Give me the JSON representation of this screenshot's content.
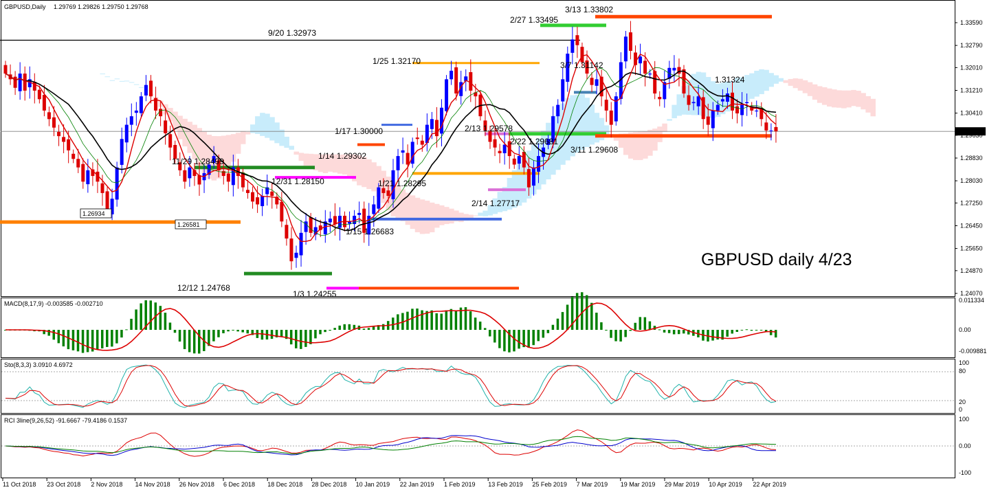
{
  "header": {
    "symbol": "GBPUSD,Daily",
    "ohlc": "1.29769 1.29826 1.29750 1.29768"
  },
  "overlay_title": "GBPUSD daily 4/23",
  "current_price_tag": "1.29768",
  "indicators": {
    "macd": {
      "label": "MACD(8,17,9) -0.003585 -0.002710",
      "axis": [
        "0.011334",
        "0.00",
        "-0.009881"
      ],
      "colors": {
        "histogram": "#008000",
        "signal": "#dd0000"
      }
    },
    "stoch": {
      "label": "Sto(8,3,3) 3.0910 4.6972",
      "axis": [
        "100",
        "80",
        "20",
        "0"
      ]
    },
    "rci": {
      "label": "RCI 3line(9,26,52) -91.6667 -79.4186 0.1537",
      "axis": [
        "100",
        "0.00",
        "-100"
      ]
    }
  },
  "chart_data": {
    "type": "candlestick",
    "instrument": "GBPUSD",
    "timeframe": "Daily",
    "ylim": [
      1.2407,
      1.3397
    ],
    "y_ticks": [
      "1.33590",
      "1.32790",
      "1.32010",
      "1.31210",
      "1.30410",
      "1.29630",
      "1.28830",
      "1.28030",
      "1.27250",
      "1.26450",
      "1.25650",
      "1.24870",
      "1.24070"
    ],
    "x_ticks": [
      "11 Oct 2018",
      "23 Oct 2018",
      "2 Nov 2018",
      "14 Nov 2018",
      "26 Nov 2018",
      "6 Dec 2018",
      "18 Dec 2018",
      "28 Dec 2018",
      "10 Jan 2019",
      "22 Jan 2019",
      "1 Feb 2019",
      "13 Feb 2019",
      "25 Feb 2019",
      "7 Mar 2019",
      "19 Mar 2019",
      "29 Mar 2019",
      "10 Apr 2019",
      "22 Apr 2019"
    ],
    "colors": {
      "bull": "#0000ff",
      "bear": "#dd0000",
      "tenkan": "#dd0000",
      "kijun": "#000000",
      "chikou": "#008000",
      "cloud_bull": "#c8ecfb",
      "cloud_bear": "#fddada"
    },
    "close": [
      1.318,
      1.316,
      1.313,
      1.318,
      1.312,
      1.316,
      1.312,
      1.309,
      1.305,
      1.302,
      1.299,
      1.296,
      1.294,
      1.291,
      1.288,
      1.285,
      1.28,
      1.284,
      1.282,
      1.28,
      1.276,
      1.27,
      1.274,
      1.285,
      1.295,
      1.3,
      1.303,
      1.305,
      1.31,
      1.314,
      1.31,
      1.305,
      1.303,
      1.297,
      1.292,
      1.288,
      1.284,
      1.28,
      1.285,
      1.282,
      1.279,
      1.283,
      1.286,
      1.289,
      1.284,
      1.282,
      1.28,
      1.285,
      1.282,
      1.278,
      1.276,
      1.273,
      1.272,
      1.275,
      1.278,
      1.275,
      1.272,
      1.266,
      1.26,
      1.252,
      1.255,
      1.262,
      1.266,
      1.262,
      1.264,
      1.263,
      1.266,
      1.267,
      1.265,
      1.268,
      1.264,
      1.266,
      1.268,
      1.269,
      1.262,
      1.268,
      1.272,
      1.278,
      1.276,
      1.275,
      1.284,
      1.289,
      1.291,
      1.286,
      1.294,
      1.295,
      1.293,
      1.3,
      1.302,
      1.296,
      1.306,
      1.316,
      1.319,
      1.311,
      1.315,
      1.317,
      1.312,
      1.31,
      1.303,
      1.298,
      1.294,
      1.292,
      1.29,
      1.293,
      1.289,
      1.286,
      1.289,
      1.285,
      1.278,
      1.285,
      1.289,
      1.292,
      1.295,
      1.303,
      1.307,
      1.316,
      1.325,
      1.33,
      1.328,
      1.322,
      1.318,
      1.314,
      1.316,
      1.31,
      1.305,
      1.3,
      1.31,
      1.322,
      1.331,
      1.326,
      1.321,
      1.324,
      1.318,
      1.318,
      1.311,
      1.309,
      1.315,
      1.32,
      1.32,
      1.318,
      1.311,
      1.307,
      1.308,
      1.31,
      1.302,
      1.3,
      1.305,
      1.307,
      1.309,
      1.311,
      1.305,
      1.304,
      1.307,
      1.308,
      1.305,
      1.305,
      1.302,
      1.298,
      1.298,
      1.2977
    ],
    "annotations": [
      {
        "text": "9/20 1.32973",
        "value": 1.32973
      },
      {
        "text": "3/13 1.33802",
        "value": 1.33802
      },
      {
        "text": "2/27 1.33495",
        "value": 1.33495
      },
      {
        "text": "1/25 1.32170",
        "value": 1.3217
      },
      {
        "text": "3/7 1.31142",
        "value": 1.31142
      },
      {
        "text": "1.31324",
        "value": 1.31324
      },
      {
        "text": "1/17 1.30000",
        "value": 1.3
      },
      {
        "text": "2/13 1.29578",
        "value": 1.29578
      },
      {
        "text": "2/22 1.29681",
        "value": 1.29681
      },
      {
        "text": "3/11 1.29608",
        "value": 1.29608
      },
      {
        "text": "1/14 1.29302",
        "value": 1.29302
      },
      {
        "text": "11/29 1.28499",
        "value": 1.28499
      },
      {
        "text": "12/31 1.28150",
        "value": 1.2815
      },
      {
        "text": "1/21 1.28295",
        "value": 1.28295
      },
      {
        "text": "2/14 1.27717",
        "value": 1.27717
      },
      {
        "text": "1.26934",
        "value": 1.26934
      },
      {
        "text": "1.26581",
        "value": 1.26581
      },
      {
        "text": "1/15 1.26683",
        "value": 1.26683
      },
      {
        "text": "12/12 1.24768",
        "value": 1.24768
      },
      {
        "text": "1/3 1.24255",
        "value": 1.24255
      }
    ]
  }
}
